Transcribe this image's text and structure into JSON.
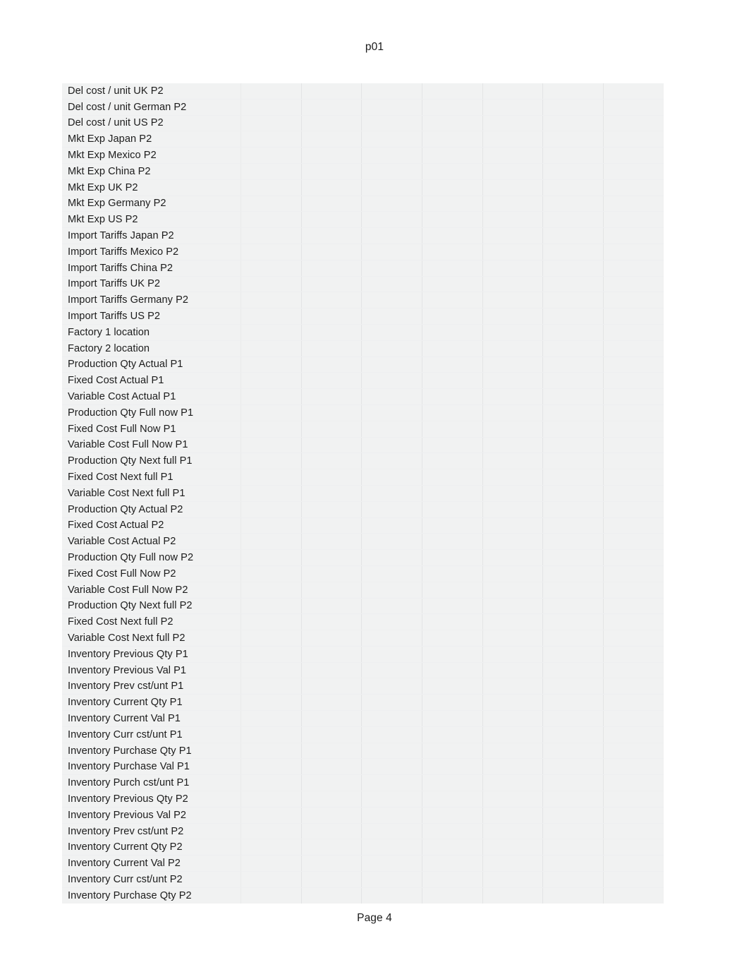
{
  "document": {
    "header_text": "p01",
    "footer_text": "Page 4"
  },
  "table": {
    "label_column_header": "",
    "data_column_count": 7,
    "rows": [
      {
        "label": "Del cost / unit UK P2",
        "values": [
          "",
          "",
          "",
          "",
          "",
          "",
          ""
        ]
      },
      {
        "label": "Del cost / unit German P2",
        "values": [
          "",
          "",
          "",
          "",
          "",
          "",
          ""
        ]
      },
      {
        "label": "Del cost / unit US P2",
        "values": [
          "",
          "",
          "",
          "",
          "",
          "",
          ""
        ]
      },
      {
        "label": "Mkt Exp Japan P2",
        "values": [
          "",
          "",
          "",
          "",
          "",
          "",
          ""
        ]
      },
      {
        "label": "Mkt Exp Mexico P2",
        "values": [
          "",
          "",
          "",
          "",
          "",
          "",
          ""
        ]
      },
      {
        "label": "Mkt Exp China P2",
        "values": [
          "",
          "",
          "",
          "",
          "",
          "",
          ""
        ]
      },
      {
        "label": "Mkt Exp UK P2",
        "values": [
          "",
          "",
          "",
          "",
          "",
          "",
          ""
        ]
      },
      {
        "label": "Mkt Exp Germany P2",
        "values": [
          "",
          "",
          "",
          "",
          "",
          "",
          ""
        ]
      },
      {
        "label": "Mkt Exp US P2",
        "values": [
          "",
          "",
          "",
          "",
          "",
          "",
          ""
        ]
      },
      {
        "label": "Import Tariffs Japan P2",
        "values": [
          "",
          "",
          "",
          "",
          "",
          "",
          ""
        ]
      },
      {
        "label": "Import Tariffs Mexico P2",
        "values": [
          "",
          "",
          "",
          "",
          "",
          "",
          ""
        ]
      },
      {
        "label": "Import Tariffs China P2",
        "values": [
          "",
          "",
          "",
          "",
          "",
          "",
          ""
        ]
      },
      {
        "label": "Import Tariffs UK P2",
        "values": [
          "",
          "",
          "",
          "",
          "",
          "",
          ""
        ]
      },
      {
        "label": "Import Tariffs Germany P2",
        "values": [
          "",
          "",
          "",
          "",
          "",
          "",
          ""
        ]
      },
      {
        "label": "Import Tariffs US P2",
        "values": [
          "",
          "",
          "",
          "",
          "",
          "",
          ""
        ]
      },
      {
        "label": "Factory 1 location",
        "values": [
          "",
          "",
          "",
          "",
          "",
          "",
          ""
        ]
      },
      {
        "label": "Factory 2 location",
        "values": [
          "",
          "",
          "",
          "",
          "",
          "",
          ""
        ]
      },
      {
        "label": "Production Qty Actual P1",
        "values": [
          "",
          "",
          "",
          "",
          "",
          "",
          ""
        ]
      },
      {
        "label": "Fixed Cost Actual P1",
        "values": [
          "",
          "",
          "",
          "",
          "",
          "",
          ""
        ]
      },
      {
        "label": "Variable Cost Actual P1",
        "values": [
          "",
          "",
          "",
          "",
          "",
          "",
          ""
        ]
      },
      {
        "label": "Production Qty Full now P1",
        "values": [
          "",
          "",
          "",
          "",
          "",
          "",
          ""
        ]
      },
      {
        "label": "Fixed Cost Full Now P1",
        "values": [
          "",
          "",
          "",
          "",
          "",
          "",
          ""
        ]
      },
      {
        "label": "Variable Cost Full Now P1",
        "values": [
          "",
          "",
          "",
          "",
          "",
          "",
          ""
        ]
      },
      {
        "label": "Production Qty Next full P1",
        "values": [
          "",
          "",
          "",
          "",
          "",
          "",
          ""
        ]
      },
      {
        "label": "Fixed Cost Next full P1",
        "values": [
          "",
          "",
          "",
          "",
          "",
          "",
          ""
        ]
      },
      {
        "label": "Variable Cost Next full P1",
        "values": [
          "",
          "",
          "",
          "",
          "",
          "",
          ""
        ]
      },
      {
        "label": "Production Qty Actual P2",
        "values": [
          "",
          "",
          "",
          "",
          "",
          "",
          ""
        ]
      },
      {
        "label": "Fixed Cost Actual P2",
        "values": [
          "",
          "",
          "",
          "",
          "",
          "",
          ""
        ]
      },
      {
        "label": "Variable Cost Actual P2",
        "values": [
          "",
          "",
          "",
          "",
          "",
          "",
          ""
        ]
      },
      {
        "label": "Production Qty Full now P2",
        "values": [
          "",
          "",
          "",
          "",
          "",
          "",
          ""
        ]
      },
      {
        "label": "Fixed Cost Full Now P2",
        "values": [
          "",
          "",
          "",
          "",
          "",
          "",
          ""
        ]
      },
      {
        "label": "Variable Cost Full Now P2",
        "values": [
          "",
          "",
          "",
          "",
          "",
          "",
          ""
        ]
      },
      {
        "label": "Production Qty Next full P2",
        "values": [
          "",
          "",
          "",
          "",
          "",
          "",
          ""
        ]
      },
      {
        "label": "Fixed Cost Next full P2",
        "values": [
          "",
          "",
          "",
          "",
          "",
          "",
          ""
        ]
      },
      {
        "label": "Variable Cost Next full P2",
        "values": [
          "",
          "",
          "",
          "",
          "",
          "",
          ""
        ]
      },
      {
        "label": "Inventory Previous Qty P1",
        "values": [
          "",
          "",
          "",
          "",
          "",
          "",
          ""
        ]
      },
      {
        "label": "Inventory Previous Val P1",
        "values": [
          "",
          "",
          "",
          "",
          "",
          "",
          ""
        ]
      },
      {
        "label": "Inventory Prev cst/unt P1",
        "values": [
          "",
          "",
          "",
          "",
          "",
          "",
          ""
        ]
      },
      {
        "label": "Inventory Current Qty P1",
        "values": [
          "",
          "",
          "",
          "",
          "",
          "",
          ""
        ]
      },
      {
        "label": "Inventory Current Val P1",
        "values": [
          "",
          "",
          "",
          "",
          "",
          "",
          ""
        ]
      },
      {
        "label": "Inventory Curr cst/unt P1",
        "values": [
          "",
          "",
          "",
          "",
          "",
          "",
          ""
        ]
      },
      {
        "label": "Inventory Purchase Qty P1",
        "values": [
          "",
          "",
          "",
          "",
          "",
          "",
          ""
        ]
      },
      {
        "label": "Inventory Purchase Val P1",
        "values": [
          "",
          "",
          "",
          "",
          "",
          "",
          ""
        ]
      },
      {
        "label": "Inventory Purch cst/unt P1",
        "values": [
          "",
          "",
          "",
          "",
          "",
          "",
          ""
        ]
      },
      {
        "label": "Inventory Previous Qty P2",
        "values": [
          "",
          "",
          "",
          "",
          "",
          "",
          ""
        ]
      },
      {
        "label": "Inventory Previous Val P2",
        "values": [
          "",
          "",
          "",
          "",
          "",
          "",
          ""
        ]
      },
      {
        "label": "Inventory Prev cst/unt P2",
        "values": [
          "",
          "",
          "",
          "",
          "",
          "",
          ""
        ]
      },
      {
        "label": "Inventory Current Qty P2",
        "values": [
          "",
          "",
          "",
          "",
          "",
          "",
          ""
        ]
      },
      {
        "label": "Inventory Current Val P2",
        "values": [
          "",
          "",
          "",
          "",
          "",
          "",
          ""
        ]
      },
      {
        "label": "Inventory Curr cst/unt P2",
        "values": [
          "",
          "",
          "",
          "",
          "",
          "",
          ""
        ]
      },
      {
        "label": "Inventory Purchase Qty P2",
        "values": [
          "",
          "",
          "",
          "",
          "",
          "",
          ""
        ]
      }
    ]
  },
  "colors": {
    "page_background": "#ffffff",
    "table_cell_background": "#f1f2f2",
    "cell_border": "#e3e4e5",
    "text": "#1c1c1c"
  }
}
